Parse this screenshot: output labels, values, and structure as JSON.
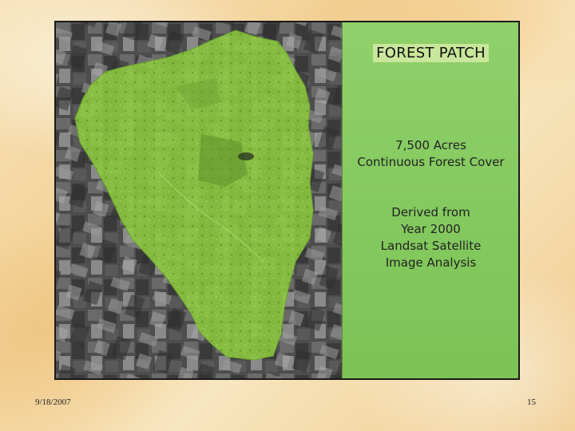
{
  "slide": {
    "panel_title": "FOREST PATCH",
    "info_block_1": [
      "7,500 Acres",
      "Continuous Forest Cover"
    ],
    "info_block_2": [
      "Derived from",
      "Year 2000",
      "Landsat Satellite",
      "Image Analysis"
    ],
    "date": "9/18/2007",
    "page_number": "15"
  },
  "colors": {
    "forest_overlay": "#8cc63f",
    "panel_green": "#85ca60",
    "slide_background": "#f4d9a4"
  }
}
